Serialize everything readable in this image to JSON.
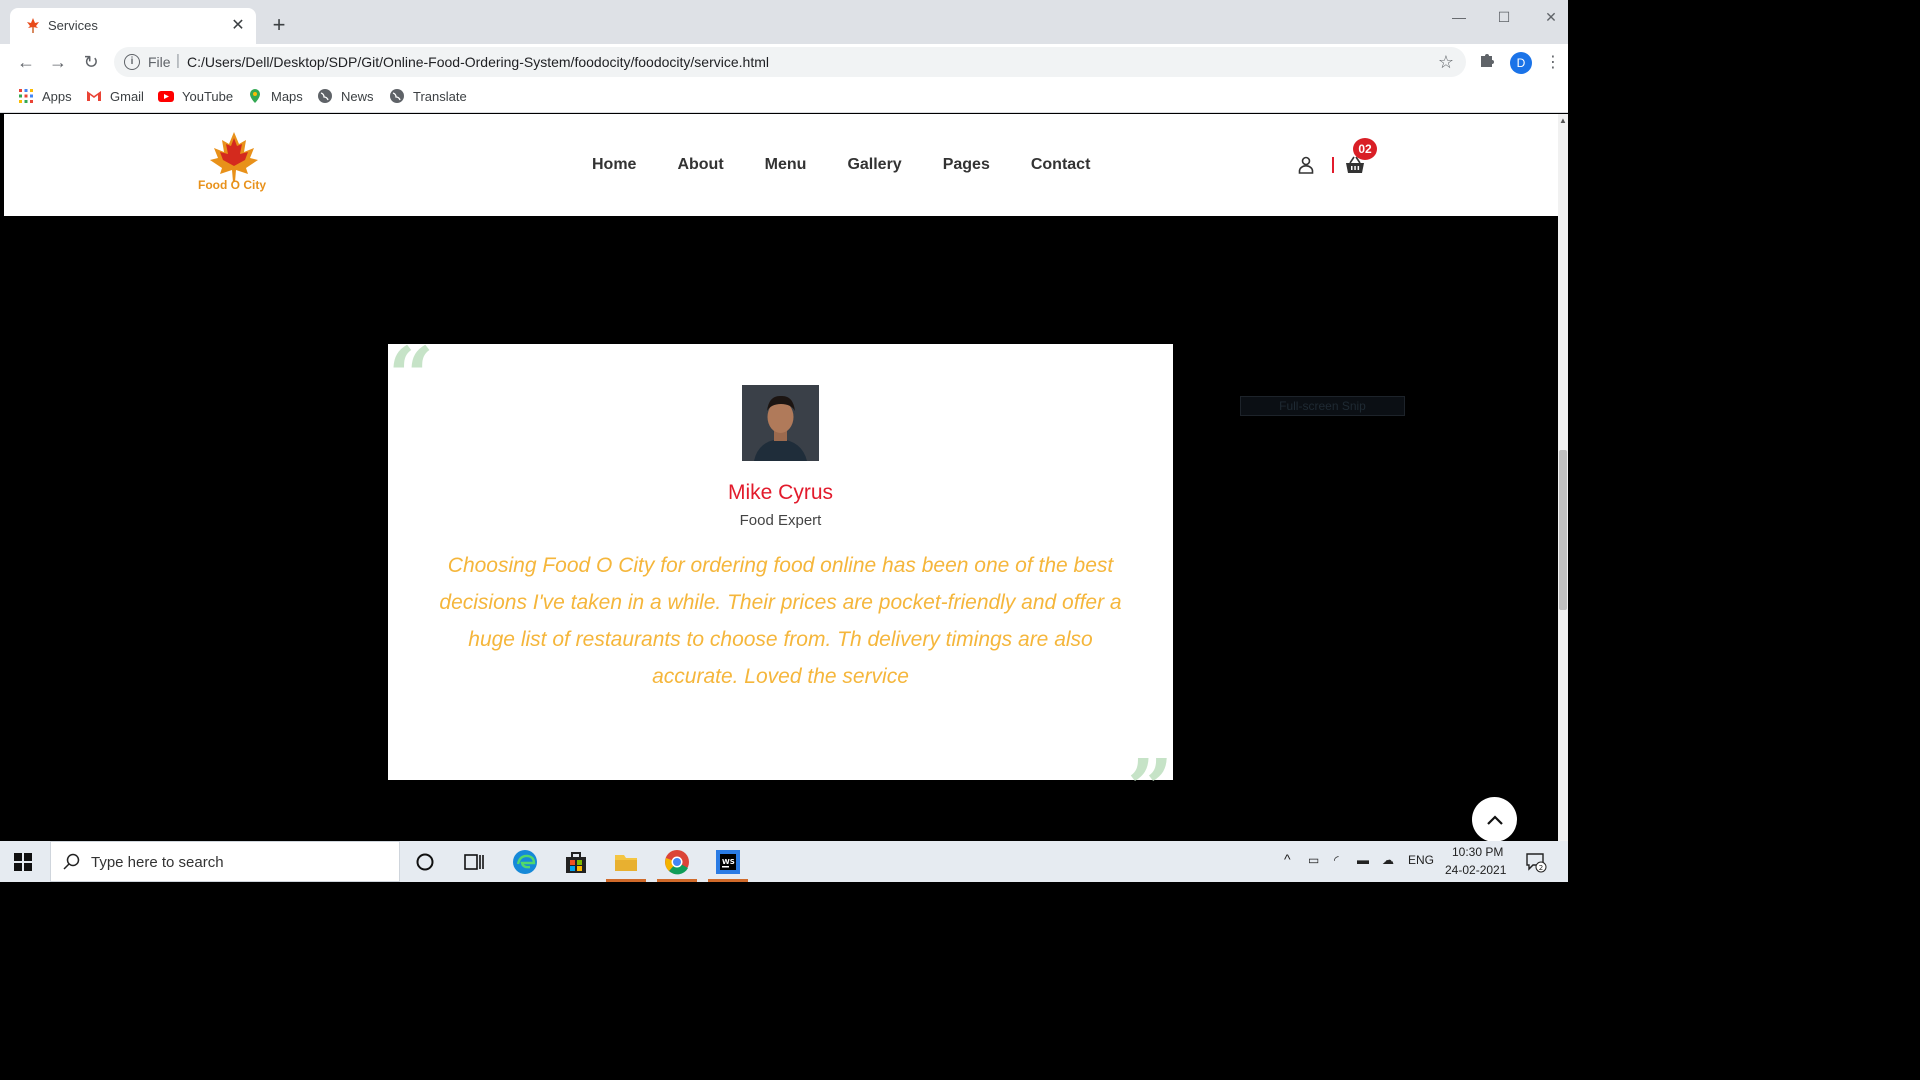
{
  "browser": {
    "tab_title": "Services",
    "file_label": "File",
    "url": "C:/Users/Dell/Desktop/SDP/Git/Online-Food-Ordering-System/foodocity/foodocity/service.html",
    "profile_initial": "D",
    "bookmarks": [
      "Apps",
      "Gmail",
      "YouTube",
      "Maps",
      "News",
      "Translate"
    ]
  },
  "site": {
    "brand": "Food O City",
    "nav": [
      "Home",
      "About",
      "Menu",
      "Gallery",
      "Pages",
      "Contact"
    ],
    "cart_count": "02",
    "testimonial": {
      "name": "Mike Cyrus",
      "role": "Food Expert",
      "quote": "Choosing Food O City for ordering food online has been one of the best decisions I've taken in a while. Their prices are pocket-friendly and offer a huge list of restaurants to choose from. Th delivery timings are also accurate. Loved the service"
    },
    "overlay_hint": "Full-screen Snip"
  },
  "taskbar": {
    "search_placeholder": "Type here to search",
    "language": "ENG",
    "time": "10:30 PM",
    "date": "24-02-2021",
    "notification_count": "2"
  },
  "colors": {
    "accent_red": "#e21b2c",
    "quote_yellow": "#f5b63b",
    "quote_mark_green": "#c6e3c7",
    "brand_orange": "#e8911a"
  }
}
